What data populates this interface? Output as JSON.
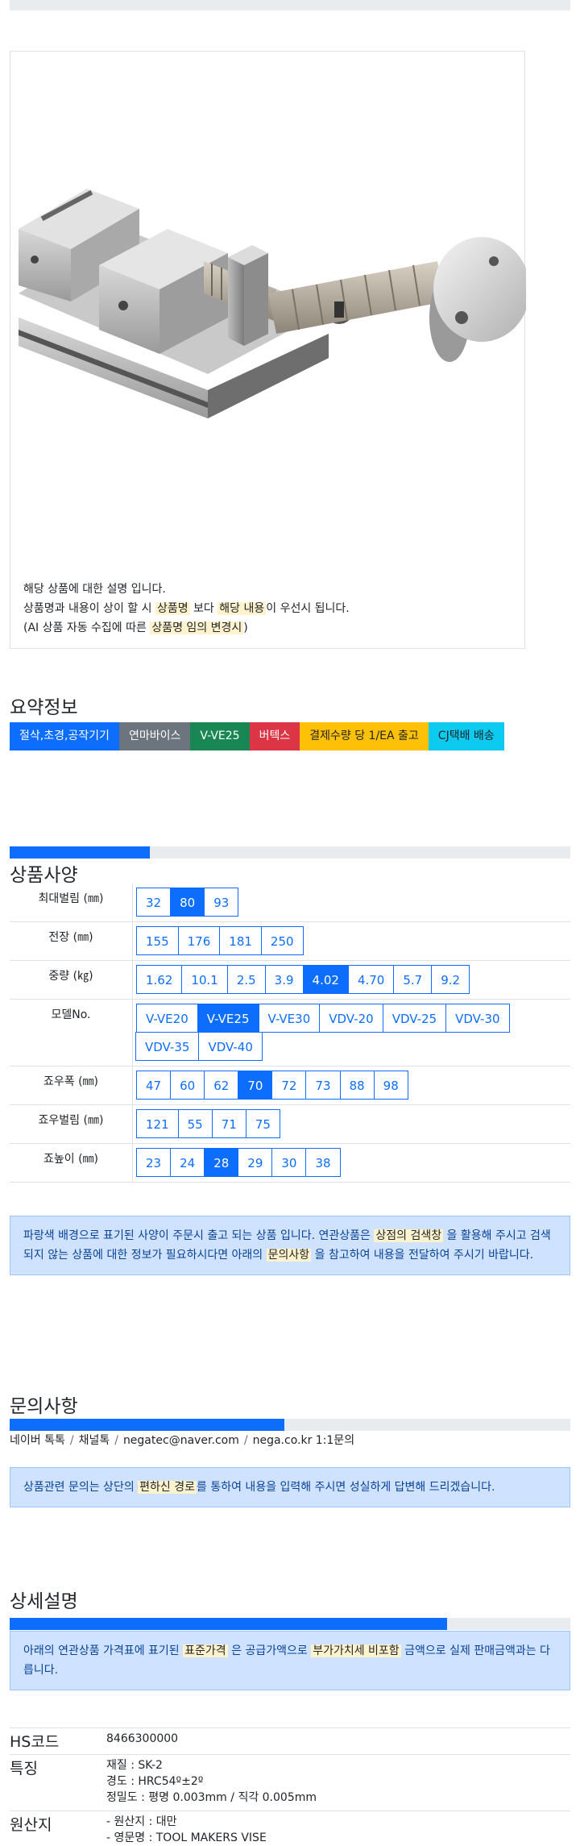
{
  "product": {
    "desc_line1": "해당 상품에 대한 설명 입니다.",
    "desc_line2_a": "상품명과 내용이 상이 할 시",
    "desc_line2_hl1": "상품명",
    "desc_line2_b": "보다",
    "desc_line2_hl2": "해당 내용",
    "desc_line2_c": "이 우선시 됩니다.",
    "desc_line3_a": "(AI 상품 자동 수집에 따른",
    "desc_line3_hl": "상품명 임의 변경시",
    "desc_line3_b": ")"
  },
  "summary": {
    "title": "요약정보",
    "badges": [
      {
        "label": "절삭,초경,공작기기",
        "color": "#0d6efd"
      },
      {
        "label": "연마바이스",
        "color": "#6c757d"
      },
      {
        "label": "V-VE25",
        "color": "#198754"
      },
      {
        "label": "버텍스",
        "color": "#dc3545"
      },
      {
        "label": "결제수량 당 1/EA 출고",
        "color": "#ffc107"
      },
      {
        "label": "CJ택배 배송",
        "color": "#0dcaf0"
      }
    ]
  },
  "spec": {
    "title": "상품사양",
    "progress": 0.25,
    "rows": [
      {
        "label": "최대벌림 (㎜)",
        "options": [
          "32",
          "80",
          "93"
        ],
        "selected": "80"
      },
      {
        "label": "전장 (㎜)",
        "options": [
          "155",
          "176",
          "181",
          "250"
        ],
        "selected": ""
      },
      {
        "label": "중량 (㎏)",
        "options": [
          "1.62",
          "10.1",
          "2.5",
          "3.9",
          "4.02",
          "4.70",
          "5.7",
          "9.2"
        ],
        "selected": "4.02"
      },
      {
        "label": "모델No.",
        "options": [
          "V-VE20",
          "V-VE25",
          "V-VE30",
          "VDV-20",
          "VDV-25",
          "VDV-30",
          "VDV-35",
          "VDV-40"
        ],
        "selected": "V-VE25"
      },
      {
        "label": "죠우폭 (㎜)",
        "options": [
          "47",
          "60",
          "62",
          "70",
          "72",
          "73",
          "88",
          "98"
        ],
        "selected": "70"
      },
      {
        "label": "죠우벌림 (㎜)",
        "options": [
          "121",
          "55",
          "71",
          "75"
        ],
        "selected": ""
      },
      {
        "label": "죠높이 (㎜)",
        "options": [
          "23",
          "24",
          "28",
          "29",
          "30",
          "38"
        ],
        "selected": "28"
      }
    ],
    "note_a": "파랑색 배경으로 표기된 사양이 주문시 출고 되는 상품 입니다. 연관상품은",
    "note_hl1": "상점의 검색창",
    "note_b": "을 활용해 주시고 검색되지 않는 상품에 대한 정보가 필요하시다면 아래의",
    "note_hl2": "문의사항",
    "note_c": "을 참고하여 내용을 전달하여 주시기 바랍니다."
  },
  "inquiry": {
    "title": "문의사항",
    "progress": 0.49,
    "contacts": [
      "네이버 톡톡",
      "채널톡",
      "negatec@naver.com",
      "nega.co.kr 1:1문의"
    ],
    "note_a": "상품관련 문의는 상단의",
    "note_hl": "편하신 경로",
    "note_b": "를 통하여 내용을 입력해 주시면 성실하게 답변해 드리겠습니다."
  },
  "detail": {
    "title": "상세설명",
    "progress": 0.78,
    "note_a": "아래의 연관상품 가격표에 표기된",
    "note_hl1": "표준가격",
    "note_b": "은 공급가액으로",
    "note_hl2": "부가가치세 비포함",
    "note_c": "금액으로 실제 판매금액과는 다릅니다.",
    "info": {
      "hs_label": "HS코드",
      "hs_value": "8466300000",
      "feature_label": "특징",
      "feature_lines": [
        "재질 : SK-2",
        "경도 : HRC54º±2º",
        "정밀도 : 평명 0.003mm / 직각 0.005mm"
      ],
      "origin_label": "원산지",
      "origin_lines": [
        "- 원산지 : 대만",
        "- 영문명 : TOOL MAKERS VISE"
      ]
    }
  }
}
